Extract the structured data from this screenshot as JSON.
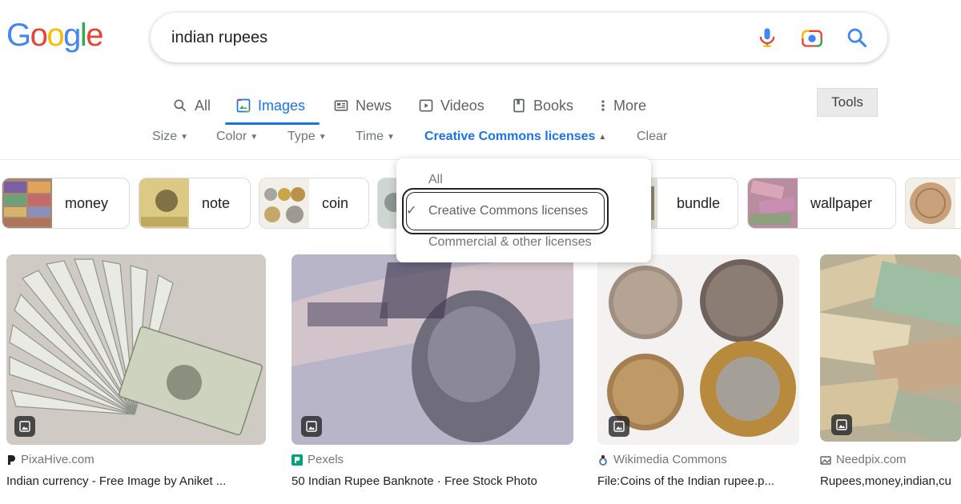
{
  "logo": {
    "letters": [
      "G",
      "o",
      "o",
      "g",
      "l",
      "e"
    ],
    "colors": [
      "#4285f4",
      "#ea4335",
      "#fbbc05",
      "#4285f4",
      "#34a853",
      "#ea4335"
    ]
  },
  "search": {
    "query": "indian rupees",
    "icons": [
      "mic-icon",
      "camera-icon",
      "search-icon"
    ]
  },
  "tabs": [
    {
      "label": "All",
      "icon": "search-icon"
    },
    {
      "label": "Images",
      "icon": "image-icon",
      "active": true
    },
    {
      "label": "News",
      "icon": "news-icon"
    },
    {
      "label": "Videos",
      "icon": "play-icon"
    },
    {
      "label": "Books",
      "icon": "book-icon"
    },
    {
      "label": "More",
      "icon": "kebab-icon"
    }
  ],
  "tools_label": "Tools",
  "filters": [
    {
      "label": "Size"
    },
    {
      "label": "Color"
    },
    {
      "label": "Type"
    },
    {
      "label": "Time"
    },
    {
      "label": "Creative Commons licenses",
      "active": true
    },
    {
      "label": "Clear"
    }
  ],
  "chips": [
    {
      "label": "money"
    },
    {
      "label": "note"
    },
    {
      "label": "coin"
    },
    {
      "label": "bundle"
    },
    {
      "label": "wallpaper"
    }
  ],
  "dropdown": {
    "items": [
      {
        "label": "All"
      },
      {
        "label": "Creative Commons licenses",
        "selected": true
      },
      {
        "label": "Commercial & other licenses"
      }
    ]
  },
  "results": [
    {
      "source": "PixaHive.com",
      "title": "Indian currency - Free Image by Aniket ...",
      "source_icon": "pixahive-icon"
    },
    {
      "source": "Pexels",
      "title": "50 Indian Rupee Banknote · Free Stock Photo",
      "source_icon": "pexels-icon"
    },
    {
      "source": "Wikimedia Commons",
      "title": "File:Coins of the Indian rupee.p...",
      "source_icon": "wikimedia-icon"
    },
    {
      "source": "Needpix.com",
      "title": "Rupees,money,indian,cu",
      "source_icon": "needpix-icon"
    }
  ],
  "colors": {
    "accent": "#1a73e8",
    "muted": "#70757a"
  }
}
